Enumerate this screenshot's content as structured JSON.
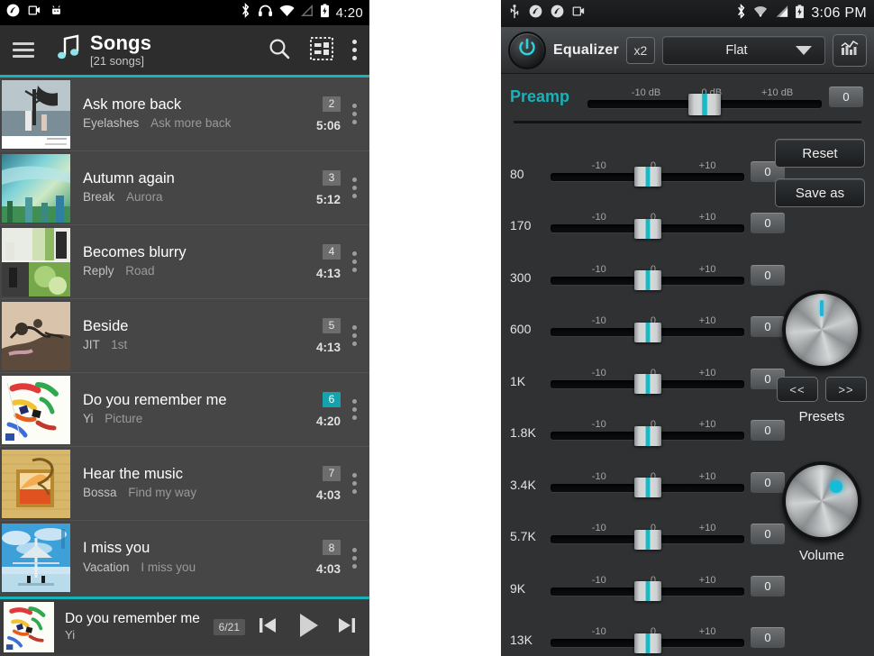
{
  "left_phone": {
    "status_bar": {
      "time": "4:20",
      "left_icons": [
        "music-app-icon",
        "screenshot-icon",
        "android-icon"
      ],
      "right_icons": [
        "bluetooth-icon",
        "headphones-icon",
        "wifi-icon",
        "signal-off-icon",
        "battery-charging-icon"
      ]
    },
    "toolbar": {
      "menu_icon": "hamburger-icon",
      "app_icon": "music-note-icon",
      "title": "Songs",
      "subtitle": "[21 songs]",
      "search_icon": "search-icon",
      "layout_icon": "grid-layout-icon",
      "overflow_icon": "kebab-menu-icon"
    },
    "songs": [
      {
        "track": "2",
        "title": "Ask more back",
        "artist": "Eyelashes",
        "album": "Ask more back",
        "duration": "5:06",
        "active": false
      },
      {
        "track": "3",
        "title": "Autumn again",
        "artist": "Break",
        "album": "Aurora",
        "duration": "5:12",
        "active": false
      },
      {
        "track": "4",
        "title": "Becomes blurry",
        "artist": "Reply",
        "album": "Road",
        "duration": "4:13",
        "active": false
      },
      {
        "track": "5",
        "title": "Beside",
        "artist": "JIT",
        "album": "1st",
        "duration": "4:13",
        "active": false
      },
      {
        "track": "6",
        "title": "Do you remember me",
        "artist": "Yi",
        "album": "Picture",
        "duration": "4:20",
        "active": true
      },
      {
        "track": "7",
        "title": "Hear the music",
        "artist": "Bossa",
        "album": "Find my way",
        "duration": "4:03",
        "active": false
      },
      {
        "track": "8",
        "title": "I miss you",
        "artist": "Vacation",
        "album": "I miss you",
        "duration": "4:03",
        "active": false
      }
    ],
    "mini_player": {
      "title": "Do you remember me",
      "artist": "Yi",
      "position": "6/21",
      "prev_icon": "skip-previous-icon",
      "play_icon": "play-icon",
      "next_icon": "skip-next-icon"
    },
    "accent_color": "#17b3b8"
  },
  "right_phone": {
    "status_bar": {
      "time": "3:06 PM",
      "left_icons": [
        "usb-icon",
        "music-app-icon",
        "music-app-icon",
        "screenshot-icon"
      ],
      "right_icons": [
        "bluetooth-icon",
        "wifi-icon",
        "signal-icon",
        "battery-charging-icon"
      ]
    },
    "header": {
      "power_icon": "power-toggle-icon",
      "title": "Equalizer",
      "multiplier_label": "x2",
      "preset_value": "Flat",
      "dropdown_icon": "chevron-down-icon",
      "spectrum_icon": "spectrum-analyzer-icon"
    },
    "preamp": {
      "label": "Preamp",
      "ticks": [
        "-10 dB",
        "0 dB",
        "+10 dB"
      ],
      "value": "0",
      "position_percent": 50
    },
    "band_ticks": [
      "-10",
      "0",
      "+10"
    ],
    "bands": [
      {
        "freq": "80",
        "value": "0",
        "position_percent": 50
      },
      {
        "freq": "170",
        "value": "0",
        "position_percent": 50
      },
      {
        "freq": "300",
        "value": "0",
        "position_percent": 50
      },
      {
        "freq": "600",
        "value": "0",
        "position_percent": 50
      },
      {
        "freq": "1K",
        "value": "0",
        "position_percent": 50
      },
      {
        "freq": "1.8K",
        "value": "0",
        "position_percent": 50
      },
      {
        "freq": "3.4K",
        "value": "0",
        "position_percent": 50
      },
      {
        "freq": "5.7K",
        "value": "0",
        "position_percent": 50
      },
      {
        "freq": "9K",
        "value": "0",
        "position_percent": 50
      },
      {
        "freq": "13K",
        "value": "0",
        "position_percent": 50
      }
    ],
    "controls": {
      "reset_label": "Reset",
      "save_as_label": "Save as",
      "presets_caption": "Presets",
      "presets_prev_label": "<<",
      "presets_next_label": ">>",
      "volume_caption": "Volume",
      "presets_knob_icon": "rotary-knob-icon",
      "volume_knob_icon": "rotary-knob-icon"
    },
    "accent_color": "#17b3b8"
  }
}
